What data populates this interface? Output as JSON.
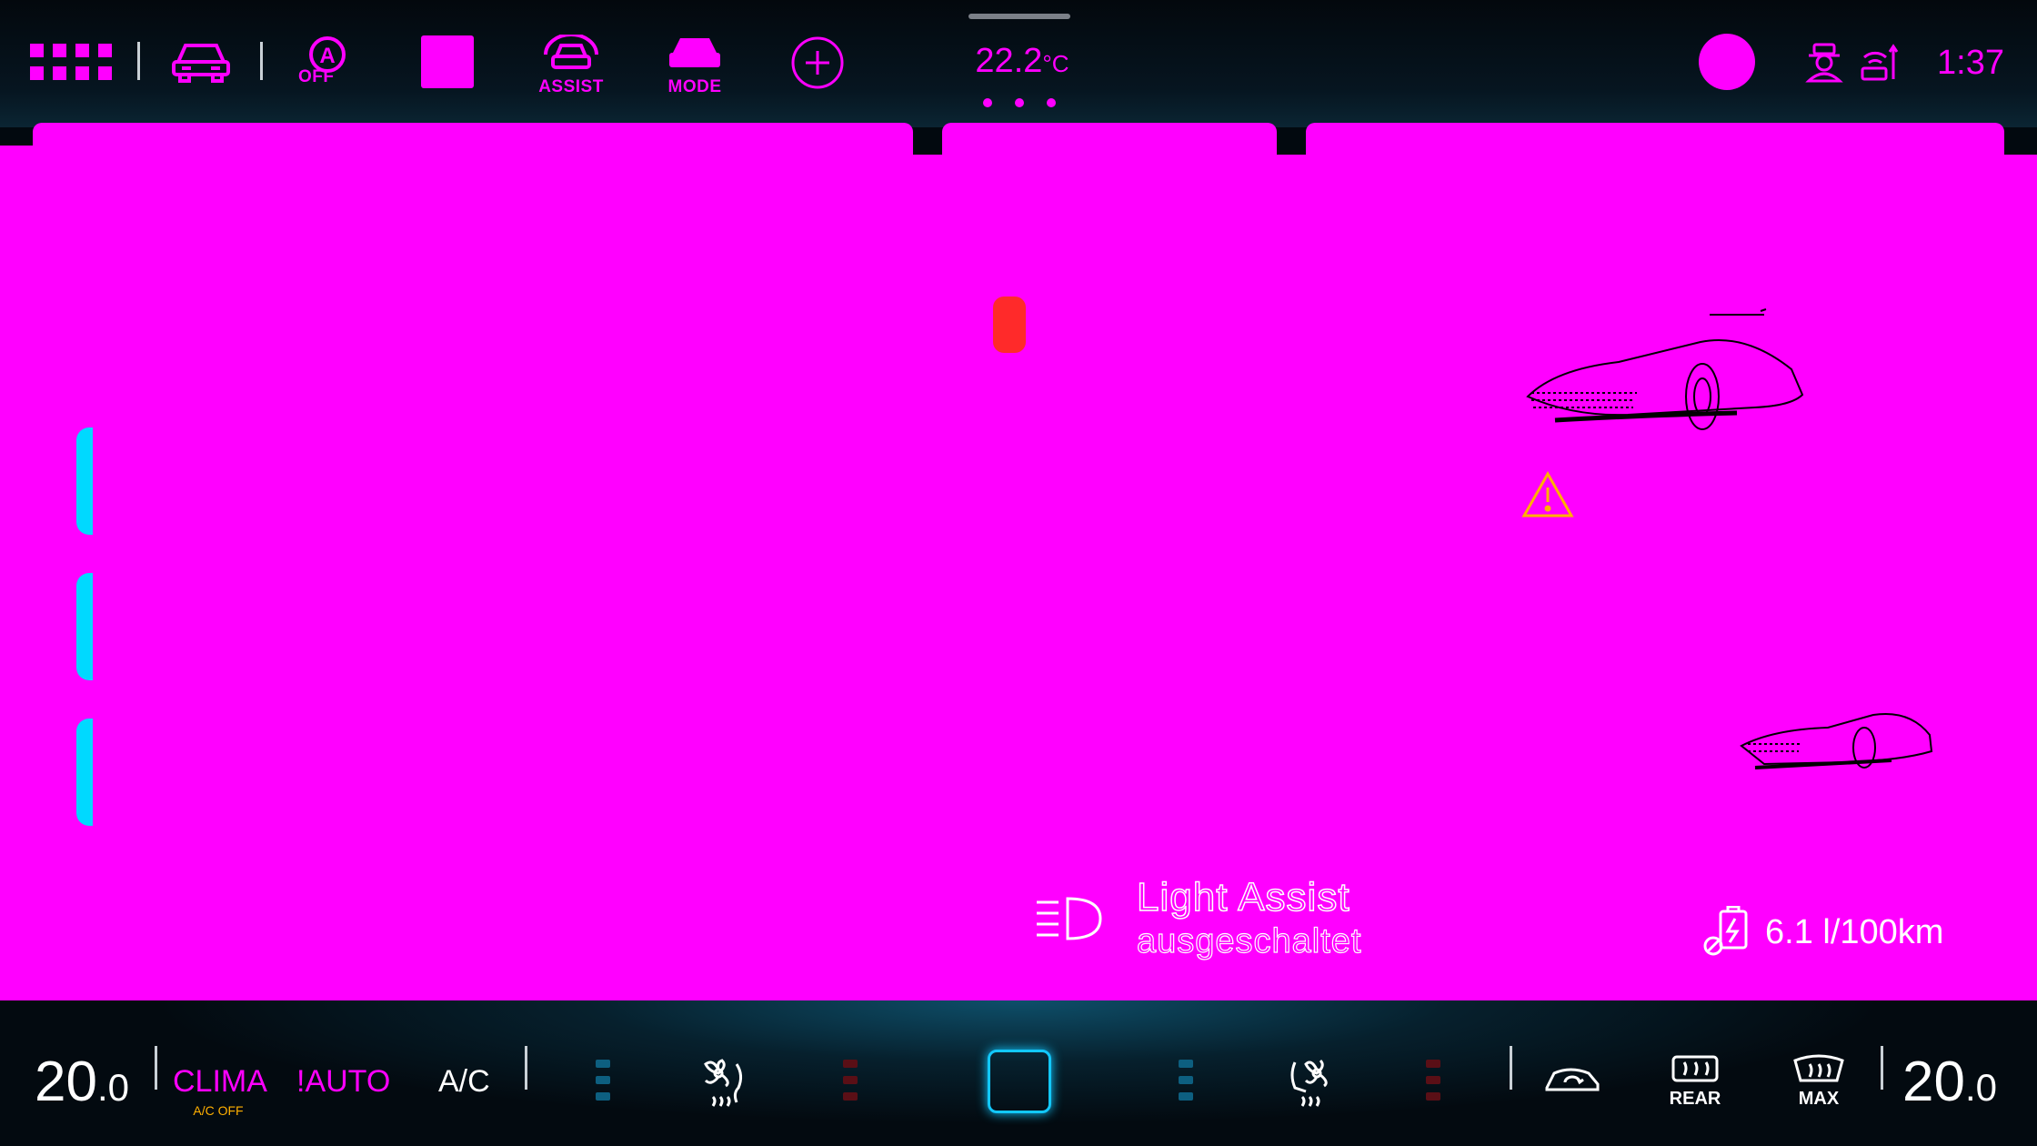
{
  "header": {
    "assist_label": "ASSIST",
    "mode_label": "MODE",
    "auto_hold_off": "OFF",
    "outside_temp": "22.2",
    "outside_temp_unit": "°C",
    "clock": "1:37"
  },
  "main": {
    "light_assist_title": "Light Assist",
    "light_assist_status": "ausgeschaltet",
    "consumption": "6.1 l/100km"
  },
  "climate": {
    "left_temp_int": "20",
    "left_temp_dec": ".0",
    "right_temp_int": "20",
    "right_temp_dec": ".0",
    "clima_label": "CLIMA",
    "ac_off_label": "A/C OFF",
    "auto_label": "!AUTO",
    "ac_label": "A/C",
    "rear_label": "REAR",
    "max_label": "MAX"
  },
  "colors": {
    "accent_magenta": "#ff00ff",
    "accent_cyan": "#00d9ff",
    "warning": "#ffb000",
    "status_red": "#ff2a2a"
  },
  "icons": [
    "apps-grid-icon",
    "car-icon",
    "auto-hold-off-icon",
    "assist-icon",
    "drive-mode-icon",
    "add-icon",
    "driver-profile-icon",
    "connectivity-icon",
    "warning-icon",
    "headlight-icon",
    "battery-charge-icon",
    "fan-icon",
    "seat-heat-icon",
    "recirculation-icon",
    "rear-defrost-icon",
    "max-defrost-icon"
  ]
}
